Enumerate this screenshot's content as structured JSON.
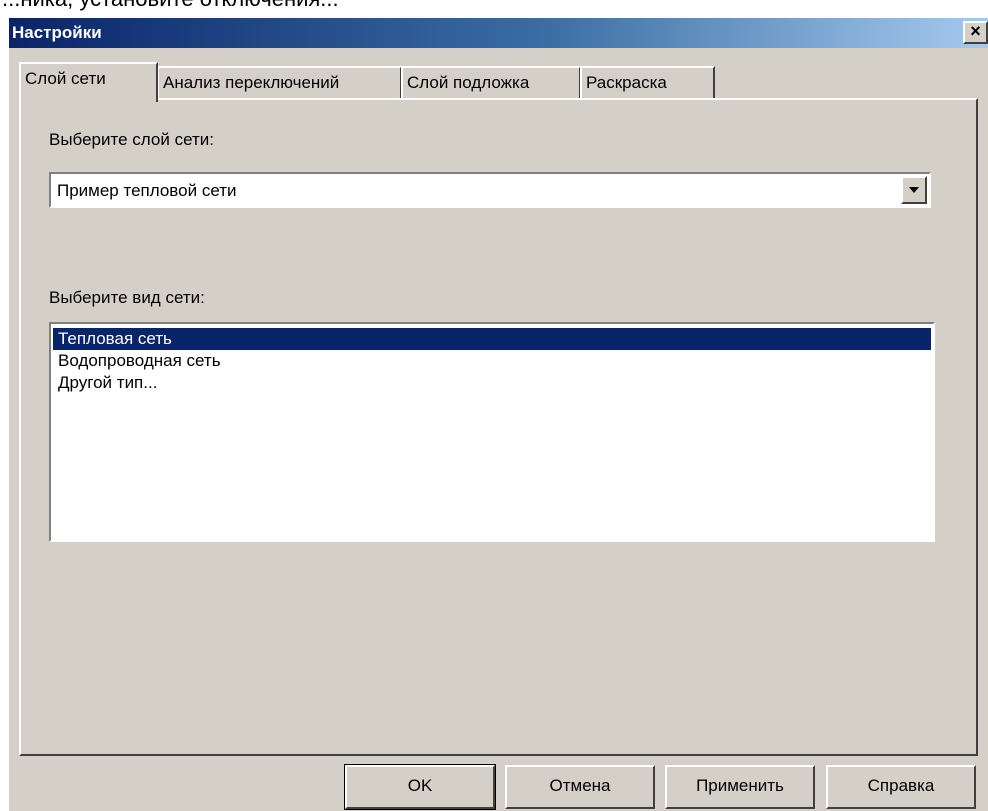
{
  "background_text": "...ника, установите отключения...",
  "window": {
    "title": "Настройки",
    "close_label": "×"
  },
  "tabs": [
    {
      "label": "Слой сети",
      "active": true
    },
    {
      "label": "Анализ переключений",
      "active": false
    },
    {
      "label": "Слой подложка",
      "active": false
    },
    {
      "label": "Раскраска",
      "active": false
    }
  ],
  "panel": {
    "layer_label": "Выберите слой сети:",
    "layer_value": "Пример тепловой сети",
    "type_label": "Выберите вид сети:",
    "types": [
      {
        "label": "Тепловая сеть",
        "selected": true
      },
      {
        "label": "Водопроводная сеть",
        "selected": false
      },
      {
        "label": "Другой тип...",
        "selected": false
      }
    ]
  },
  "buttons": {
    "ok": "OK",
    "cancel": "Отмена",
    "apply": "Применить",
    "help": "Справка"
  },
  "colors": {
    "dialog_bg": "#d4d0c8",
    "title_start": "#0a246a",
    "title_end": "#a6caf0",
    "selection": "#0a246a"
  }
}
